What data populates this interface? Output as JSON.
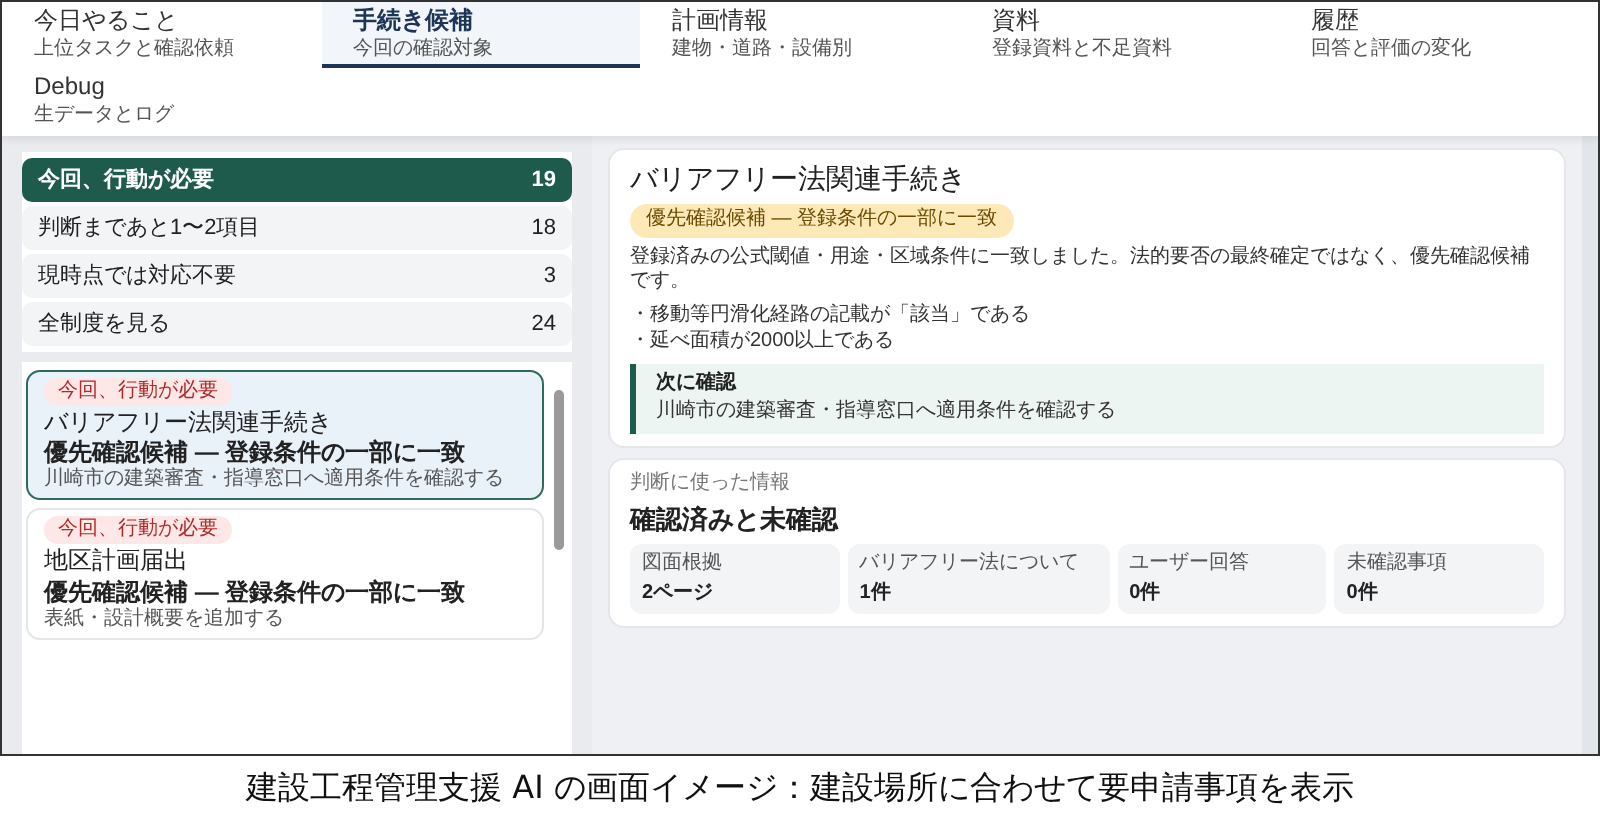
{
  "tabs": [
    {
      "label": "今日やること",
      "sublabel": "上位タスクと確認依頼",
      "selected": false
    },
    {
      "label": "手続き候補",
      "sublabel": "今回の確認対象",
      "selected": true
    },
    {
      "label": "計画情報",
      "sublabel": "建物・道路・設備別",
      "selected": false
    },
    {
      "label": "資料",
      "sublabel": "登録資料と不足資料",
      "selected": false
    },
    {
      "label": "履歴",
      "sublabel": "回答と評価の変化",
      "selected": false
    },
    {
      "label": "Debug",
      "sublabel": "生データとログ",
      "selected": false
    }
  ],
  "filters": [
    {
      "label": "今回、行動が必要",
      "count": "19",
      "selected": true
    },
    {
      "label": "判断まであと1〜2項目",
      "count": "18",
      "selected": false
    },
    {
      "label": "現時点では対応不要",
      "count": "3",
      "selected": false
    },
    {
      "label": "全制度を見る",
      "count": "24",
      "selected": false
    }
  ],
  "procedure_cards": [
    {
      "tag": "今回、行動が必要",
      "title": "バリアフリー法関連手続き",
      "status": "優先確認候補 — 登録条件の一部に一致",
      "next_step": "川崎市の建築審査・指導窓口へ適用条件を確認する",
      "selected": true
    },
    {
      "tag": "今回、行動が必要",
      "title": "地区計画届出",
      "status": "優先確認候補 — 登録条件の一部に一致",
      "next_step": "表紙・設計概要を追加する",
      "selected": false
    }
  ],
  "detail": {
    "title": "バリアフリー法関連手続き",
    "badge": "優先確認候補 — 登録条件の一部に一致",
    "summary": "登録済みの公式閾値・用途・区域条件に一致しました。法的要否の最終確定ではなく、優先確認候補です。",
    "conditions": [
      "・移動等円滑化経路の記載が「該当」である",
      "・延べ面積が2000以上である"
    ],
    "next_check": {
      "heading": "次に確認",
      "text": "川崎市の建築審査・指導窓口へ適用条件を確認する"
    }
  },
  "evidence": {
    "eyebrow": "判断に使った情報",
    "title": "確認済みと未確認",
    "stats": [
      {
        "label": "図面根拠",
        "value": "2ページ"
      },
      {
        "label": "バリアフリー法について",
        "value": "1件"
      },
      {
        "label": "ユーザー回答",
        "value": "0件"
      },
      {
        "label": "未確認事項",
        "value": "0件"
      }
    ]
  },
  "caption": "建設工程管理支援 AI の画面イメージ：建設場所に合わせて要申請事項を表示"
}
